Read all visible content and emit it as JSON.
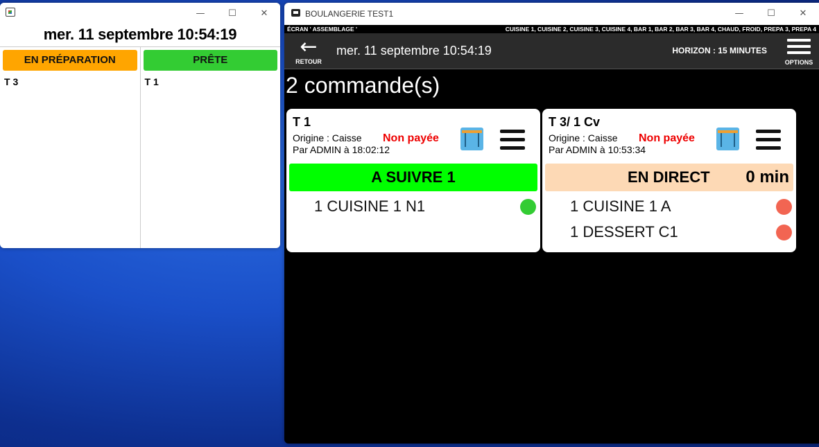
{
  "left_window": {
    "clock": "mer. 11 septembre 10:54:19",
    "columns": [
      {
        "header": "EN PRÉPARATION",
        "color": "#FFA500",
        "items": [
          "T 3"
        ]
      },
      {
        "header": "PRÊTE",
        "color": "#33CC33",
        "items": [
          "T 1"
        ]
      }
    ],
    "controls": {
      "minimize": "—",
      "maximize": "☐",
      "close": "✕"
    }
  },
  "right_window": {
    "title": "BOULANGERIE TEST1",
    "screen_label": "ÉCRAN ' ASSEMBLAGE '",
    "stations": "CUISINE 1, CUISINE 2, CUISINE 3, CUISINE 4, BAR 1, BAR 2, BAR 3, BAR 4, CHAUD, FROID, PREPA 3, PREPA 4",
    "back_label": "RETOUR",
    "clock": "mer. 11 septembre 10:54:19",
    "horizon": "HORIZON : 15 MINUTES",
    "options_label": "OPTIONS",
    "count_text": "2 commande(s)",
    "controls": {
      "minimize": "—",
      "maximize": "☐",
      "close": "✕"
    }
  },
  "orders": [
    {
      "table": "T 1",
      "origin": "Origine : Caisse",
      "by": "Par ADMIN à 18:02:12",
      "payment": "Non payée",
      "status": "A SUIVRE 1",
      "status_color": "#00FF00",
      "timer": "",
      "lines": [
        {
          "text": "1 CUISINE 1  N1",
          "dot_color": "#33CC33"
        }
      ]
    },
    {
      "table": "T 3/ 1 Cv",
      "origin": "Origine : Caisse",
      "by": "Par ADMIN à 10:53:34",
      "payment": "Non payée",
      "status": "EN DIRECT",
      "status_color": "#FDD9B5",
      "timer": "0 min",
      "lines": [
        {
          "text": "1 CUISINE 1 A",
          "dot_color": "#F26552"
        },
        {
          "text": "1 DESSERT C1",
          "dot_color": "#F26552"
        }
      ]
    }
  ]
}
